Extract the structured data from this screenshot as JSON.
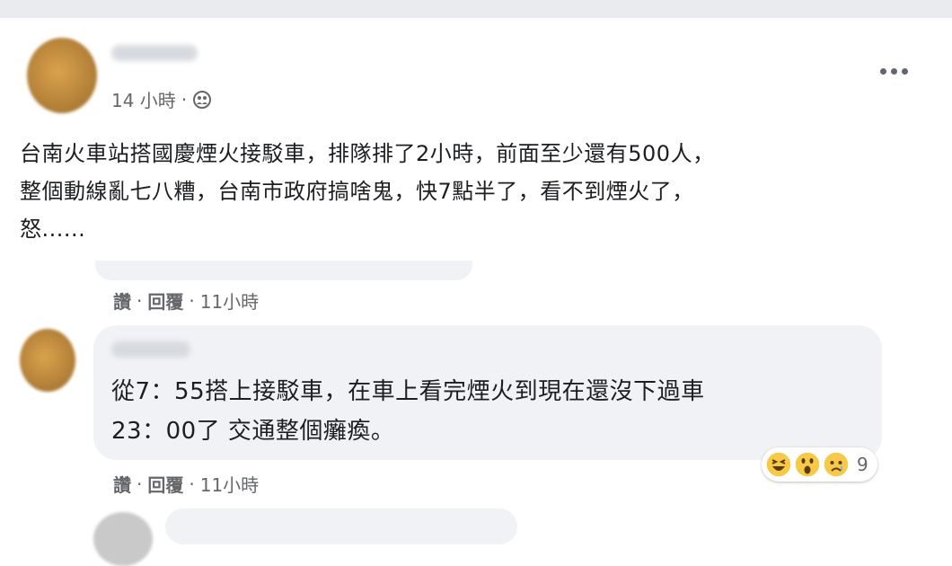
{
  "post": {
    "time": "14 小時",
    "separator": "·",
    "text": "台南火車站搭國慶煙火接駁車，排隊排了2小時，前面至少還有500人，\n整個動線亂七八糟，台南市政府搞啥鬼，快7點半了，看不到煙火了，\n怒......",
    "privacy_icon": "friends-icon",
    "menu_icon": "more-options-icon"
  },
  "reply_actions": {
    "like": "讚",
    "reply": "回覆",
    "time": "11小時",
    "separator": "·"
  },
  "comment": {
    "text": "從7：55搭上接駁車，在車上看完煙火到現在還沒下過車\n23：00了 交通整個癱瘓。",
    "reaction_count": "9",
    "reaction_icons": [
      "laughing-emoji-icon",
      "wow-emoji-icon",
      "sad-emoji-icon"
    ],
    "actions": {
      "like": "讚",
      "reply": "回覆",
      "time": "11小時",
      "separator": "·"
    }
  },
  "colors": {
    "bubble": "#f0f2f5",
    "meta_text": "#65676b",
    "body_text": "#1c1e21"
  }
}
